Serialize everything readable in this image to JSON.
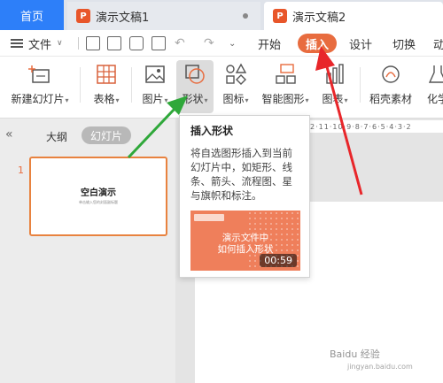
{
  "tabs": {
    "home": "首页",
    "doc1": "演示文稿1",
    "doc2": "演示文稿2",
    "doc_icon": "P"
  },
  "menu": {
    "file": "文件",
    "start": "开始",
    "insert": "插入",
    "design": "设计",
    "transition": "切换",
    "animation": "动"
  },
  "ribbon": {
    "new_slide": "新建幻灯片",
    "table": "表格",
    "picture": "图片",
    "shape": "形状",
    "icon": "图标",
    "smart_shape": "智能图形",
    "chart": "图表",
    "docer_material": "稻壳素材",
    "chemistry": "化学"
  },
  "left_pane": {
    "outline_tab": "大纲",
    "slides_tab": "幻灯片",
    "slide_number": "1",
    "thumb_title": "空白演示",
    "thumb_subtitle": "单击输入您的封面副标题"
  },
  "ruler": {
    "text": "2·11·10·9·8·7·6·5·4·3·2"
  },
  "tooltip": {
    "title": "插入形状",
    "description": "将自选图形插入到当前幻灯片中，如矩形、线条、箭头、流程图、星与旗帜和标注。",
    "video_caption_line1": "演示文件中",
    "video_caption_line2": "如何插入形状",
    "video_duration": "00:59"
  },
  "watermark": {
    "line1": "Baidu 经验",
    "line2": "jingyan.baidu.com"
  },
  "colors": {
    "home_tab": "#2d7ff9",
    "insert_pill": "#e86c3f",
    "thumb_border": "#e8823f",
    "video_bg": "#ef7f5b",
    "red_arrow": "#e8262a",
    "green_arrow": "#2fa83a"
  }
}
